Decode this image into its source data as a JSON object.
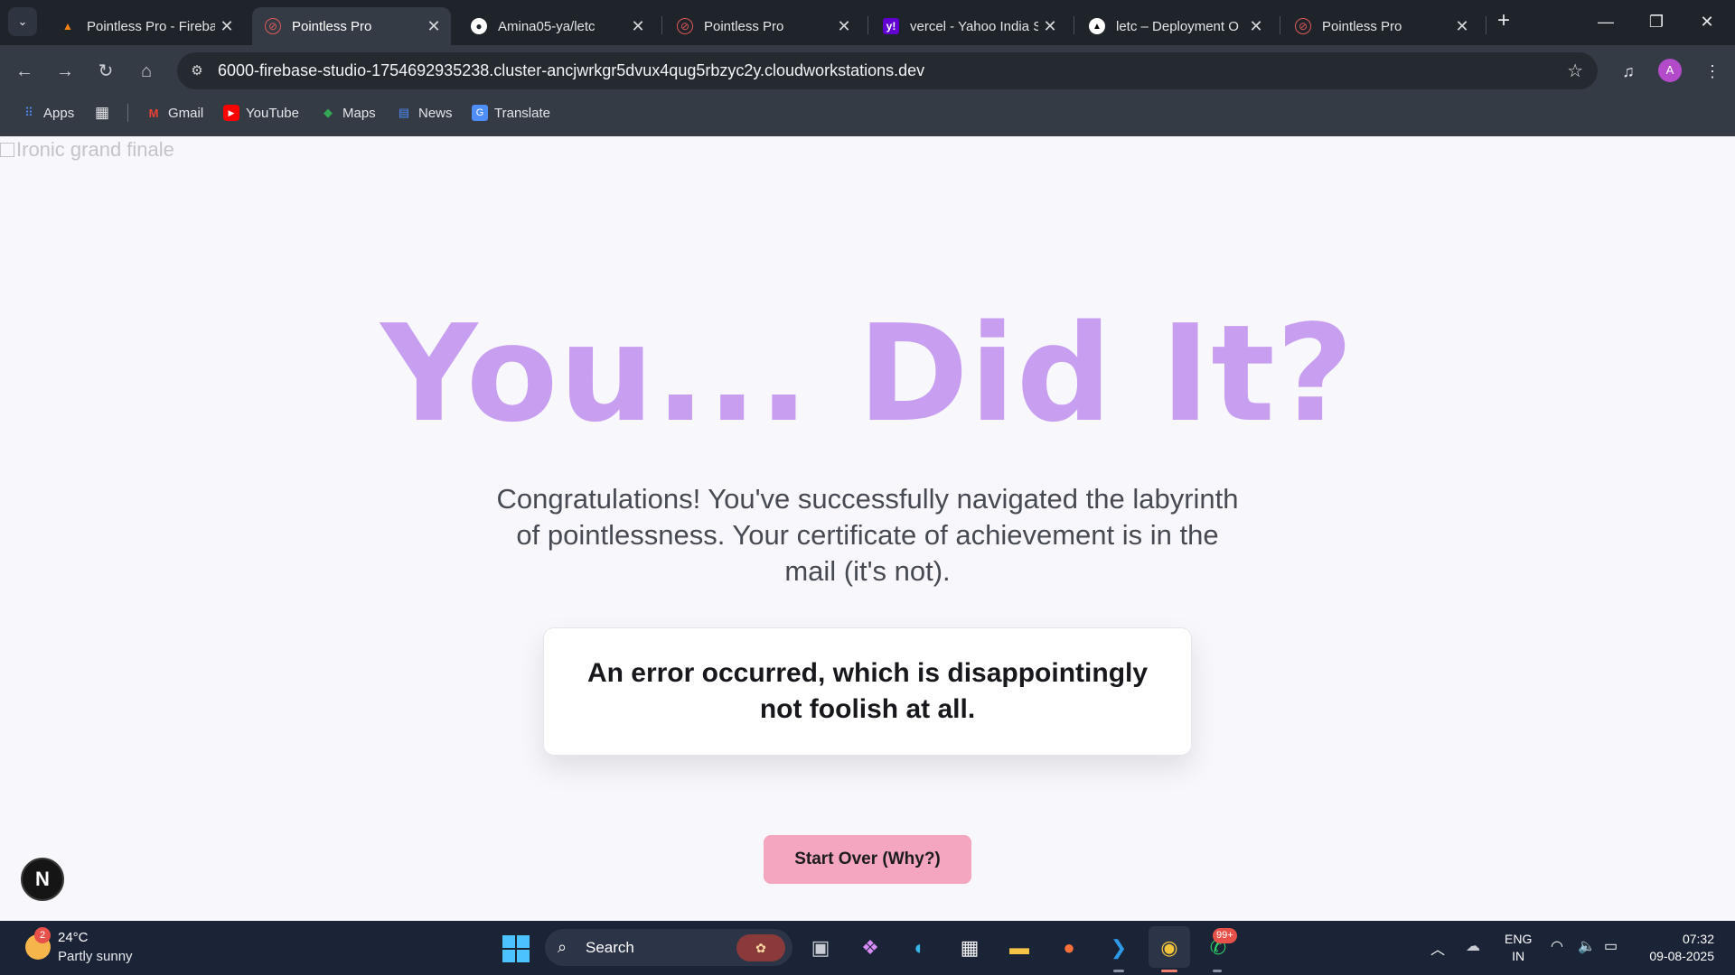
{
  "browser": {
    "tabs": [
      {
        "title": "Pointless Pro - Fireba",
        "favicon": "firebase-icon"
      },
      {
        "title": "Pointless Pro",
        "favicon": "pointless-icon",
        "active": true
      },
      {
        "title": "Amina05-ya/letc",
        "favicon": "github-icon"
      },
      {
        "title": "Pointless Pro",
        "favicon": "pointless-icon"
      },
      {
        "title": "vercel - Yahoo India S",
        "favicon": "yahoo-icon"
      },
      {
        "title": "letc – Deployment O",
        "favicon": "vercel-icon"
      },
      {
        "title": "Pointless Pro",
        "favicon": "pointless-icon"
      }
    ],
    "url": "6000-firebase-studio-1754692935238.cluster-ancjwrkgr5dvux4qug5rbzyc2y.cloudworkstations.dev",
    "profile_initial": "A",
    "bookmarks": [
      {
        "label": "Apps",
        "icon": "apps-grid-icon"
      },
      {
        "label": "Gmail",
        "icon": "gmail-icon"
      },
      {
        "label": "YouTube",
        "icon": "youtube-icon"
      },
      {
        "label": "Maps",
        "icon": "maps-icon"
      },
      {
        "label": "News",
        "icon": "news-icon"
      },
      {
        "label": "Translate",
        "icon": "translate-icon"
      }
    ]
  },
  "page": {
    "broken_image_alt": "Ironic grand finale",
    "headline": "You... Did It?",
    "subtext": "Congratulations! You've successfully navigated the labyrinth of pointlessness. Your certificate of achievement is in the mail (it's not).",
    "error_message": "An error occurred, which is disappointingly not foolish at all.",
    "start_over_label": "Start Over (Why?)",
    "floating_badge": "N",
    "colors": {
      "headline": "#c89ef0",
      "button": "#f4a6c0",
      "background": "#f8f7fb"
    }
  },
  "taskbar": {
    "weather_temp": "24°C",
    "weather_desc": "Partly sunny",
    "weather_badge": "2",
    "search_label": "Search",
    "whatsapp_badge": "99+",
    "lang_top": "ENG",
    "lang_bottom": "IN",
    "time": "07:32",
    "date": "09-08-2025"
  }
}
